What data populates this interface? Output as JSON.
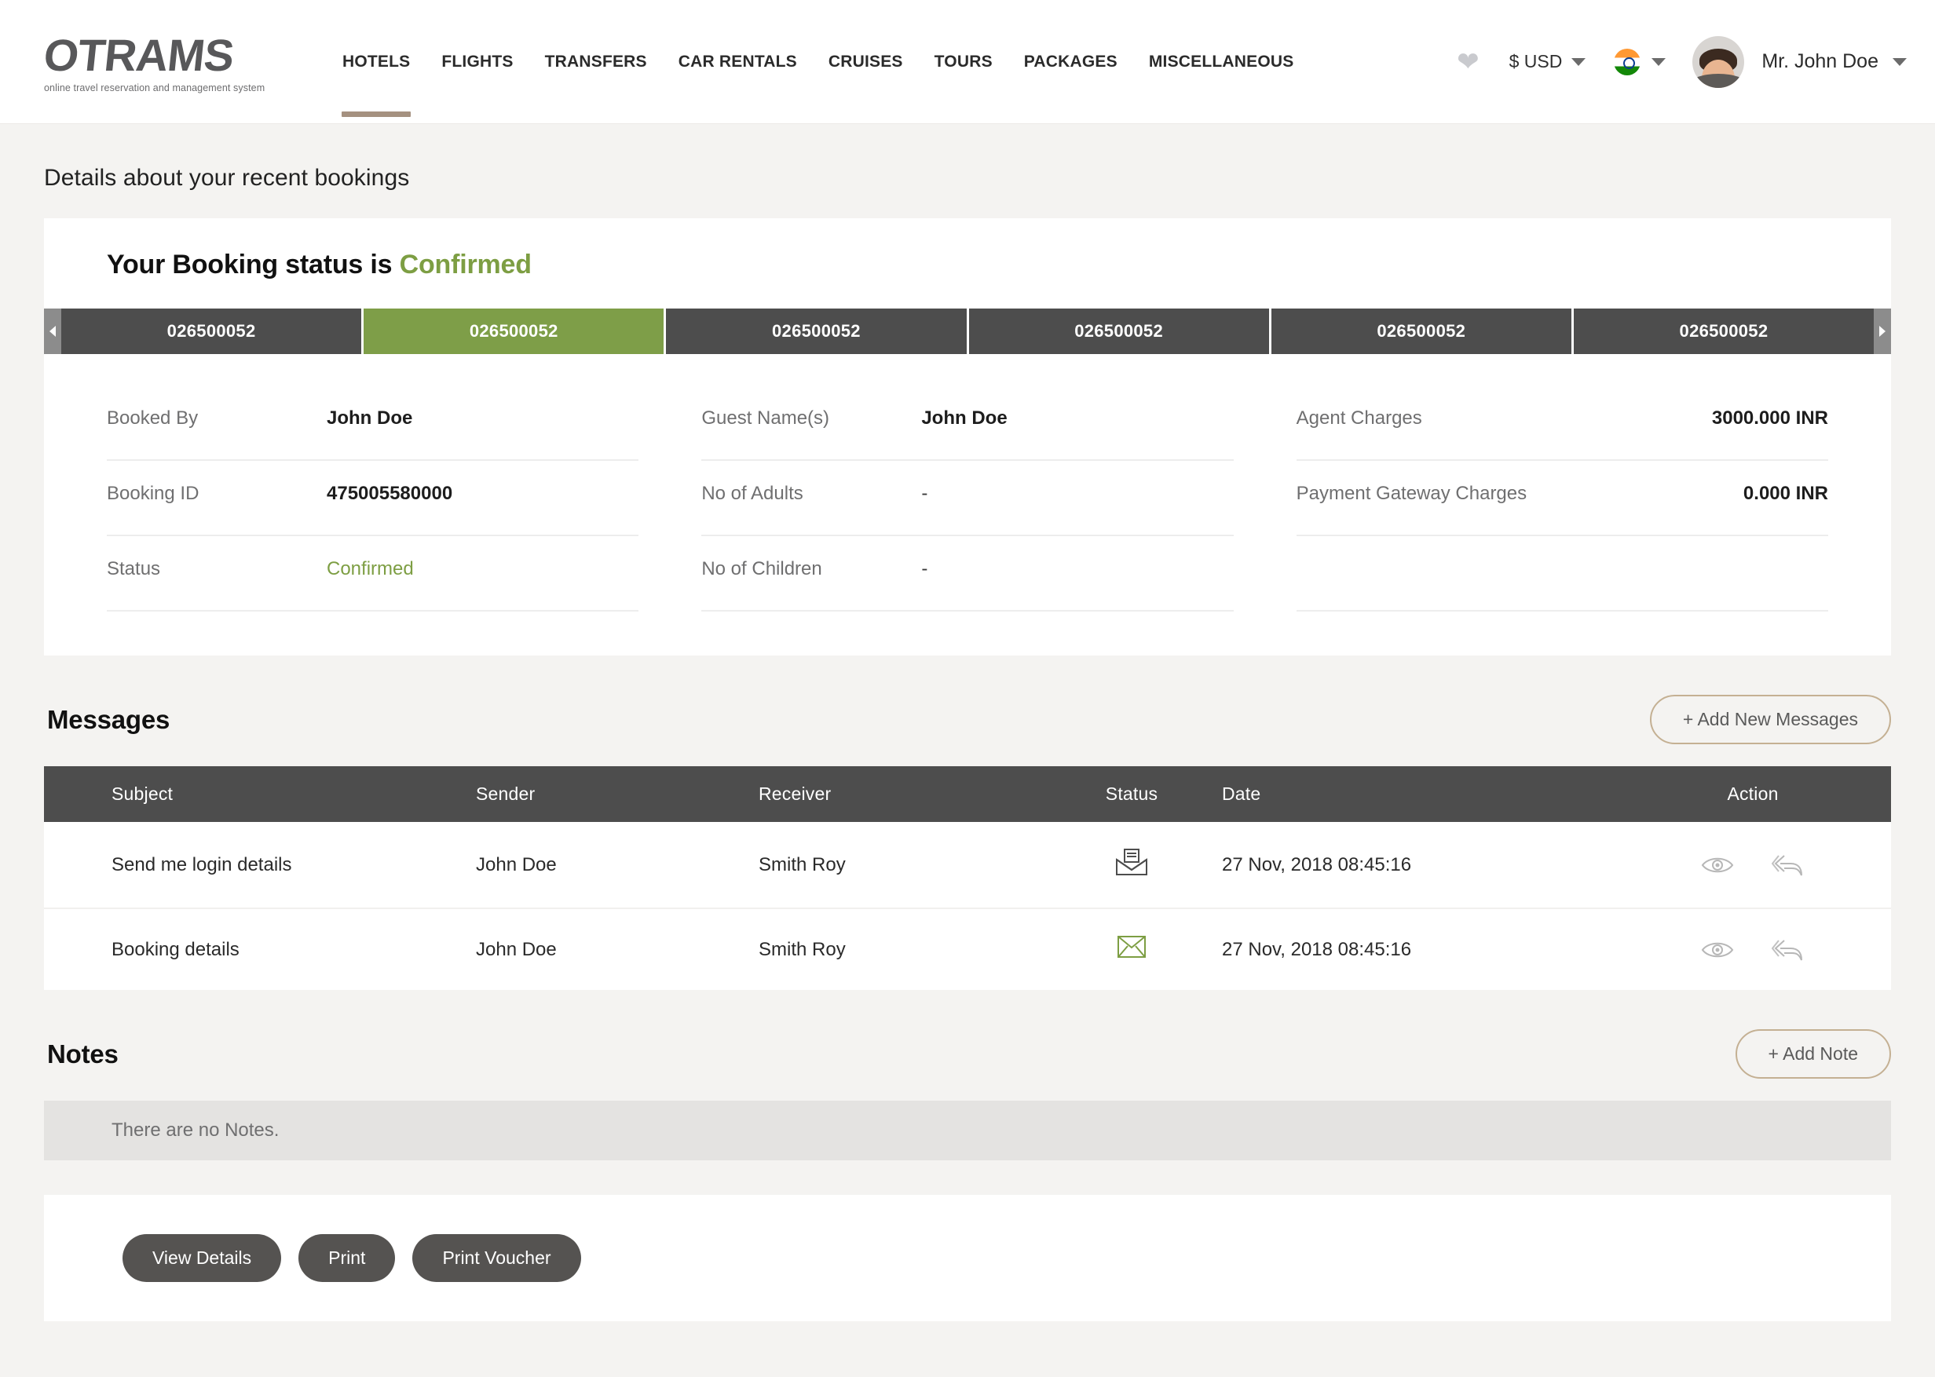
{
  "header": {
    "logo": {
      "name": "OTRAMS",
      "tagline": "online travel reservation and management system"
    },
    "nav": [
      {
        "label": "HOTELS",
        "active": true
      },
      {
        "label": "FLIGHTS",
        "active": false
      },
      {
        "label": "TRANSFERS",
        "active": false
      },
      {
        "label": "CAR RENTALS",
        "active": false
      },
      {
        "label": "CRUISES",
        "active": false
      },
      {
        "label": "TOURS",
        "active": false
      },
      {
        "label": "PACKAGES",
        "active": false
      },
      {
        "label": "MISCELLANEOUS",
        "active": false
      }
    ],
    "wishlist_icon": "heart-icon",
    "currency": "$ USD",
    "language_flag": "india-flag-icon",
    "user_name": "Mr. John Doe"
  },
  "page": {
    "title": "Details about your recent bookings"
  },
  "booking": {
    "status_prefix": "Your Booking status is ",
    "status_value": "Confirmed",
    "tabs": [
      {
        "label": "026500052",
        "active": false
      },
      {
        "label": "026500052",
        "active": true
      },
      {
        "label": "026500052",
        "active": false
      },
      {
        "label": "026500052",
        "active": false
      },
      {
        "label": "026500052",
        "active": false
      },
      {
        "label": "026500052",
        "active": false
      }
    ],
    "prev_arrow": "chevron-left-icon",
    "next_arrow": "chevron-right-icon",
    "columns": [
      [
        {
          "label": "Booked By",
          "value": "John Doe",
          "style": "bold"
        },
        {
          "label": "Booking ID",
          "value": "475005580000",
          "style": "bold"
        },
        {
          "label": "Status",
          "value": "Confirmed",
          "style": "green"
        }
      ],
      [
        {
          "label": "Guest Name(s)",
          "value": "John Doe",
          "style": "bold"
        },
        {
          "label": "No of Adults",
          "value": "-",
          "style": "muted"
        },
        {
          "label": "No of Children",
          "value": "-",
          "style": "muted"
        }
      ],
      [
        {
          "label": "Agent Charges",
          "value": "3000.000 INR",
          "style": "bold"
        },
        {
          "label": "Payment Gateway Charges",
          "value": "0.000 INR",
          "style": "bold"
        },
        {
          "label": "",
          "value": "",
          "style": "empty"
        }
      ]
    ]
  },
  "messages": {
    "title": "Messages",
    "add_button": "+ Add New Messages",
    "columns": [
      "Subject",
      "Sender",
      "Receiver",
      "Status",
      "Date",
      "Action"
    ],
    "rows": [
      {
        "subject": "Send me login details",
        "sender": "John Doe",
        "receiver": "Smith Roy",
        "status_icon": "envelope-open-icon",
        "status_color": "#4d4d4d",
        "date": "27 Nov, 2018 08:45:16",
        "actions": [
          "view-icon",
          "reply-icon"
        ]
      },
      {
        "subject": "Booking details",
        "sender": "John Doe",
        "receiver": "Smith Roy",
        "status_icon": "envelope-closed-icon",
        "status_color": "#7d9e43",
        "date": "27 Nov, 2018 08:45:16",
        "actions": [
          "view-icon",
          "reply-icon"
        ]
      }
    ]
  },
  "notes": {
    "title": "Notes",
    "add_button": "+ Add Note",
    "empty_text": "There are no Notes."
  },
  "footer_actions": {
    "view_details": "View Details",
    "print": "Print",
    "print_voucher": "Print Voucher"
  },
  "colors": {
    "accent_green": "#7e9e48",
    "tan": "#c4b093",
    "dark_grey": "#4d4d4d",
    "button_grey": "#555351"
  }
}
